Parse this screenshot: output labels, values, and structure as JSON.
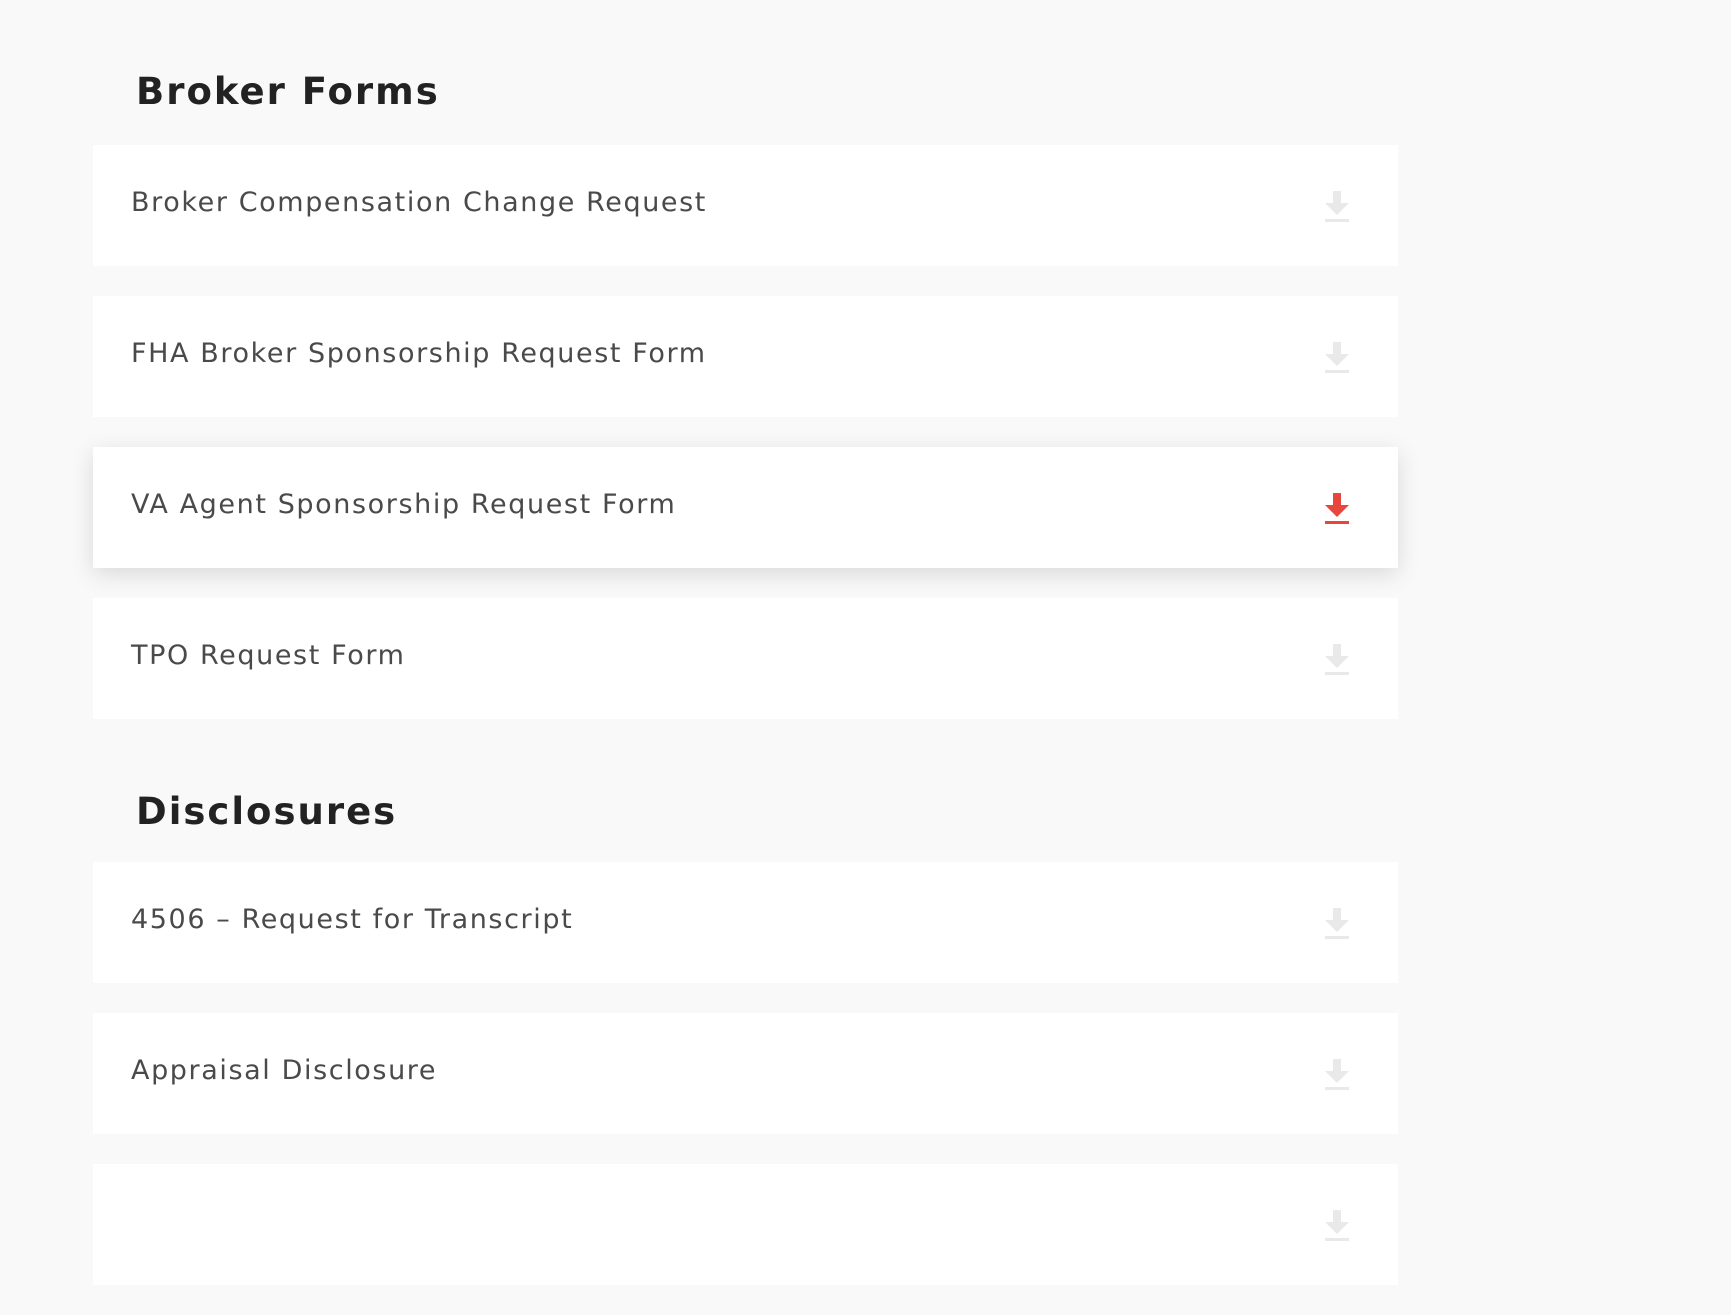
{
  "sections": [
    {
      "title": "Broker Forms",
      "items": [
        {
          "label": "Broker Compensation Change Request",
          "icon": "download-icon",
          "active": false
        },
        {
          "label": "FHA Broker Sponsorship Request Form",
          "icon": "download-icon",
          "active": false
        },
        {
          "label": "VA Agent Sponsorship Request Form",
          "icon": "download-icon",
          "active": true
        },
        {
          "label": "TPO Request Form",
          "icon": "download-icon",
          "active": false
        }
      ]
    },
    {
      "title": "Disclosures",
      "items": [
        {
          "label": "4506 – Request for Transcript",
          "icon": "download-icon",
          "active": false
        },
        {
          "label": "Appraisal Disclosure",
          "icon": "download-icon",
          "active": false
        },
        {
          "label": "",
          "icon": "download-icon",
          "active": false
        }
      ]
    }
  ],
  "colors": {
    "page_background": "#f9f9f9",
    "card_background": "#ffffff",
    "icon_inactive": "#e9e9e9",
    "icon_active": "#e8453c",
    "heading_text": "#222222",
    "item_text": "#4a4a4a"
  }
}
